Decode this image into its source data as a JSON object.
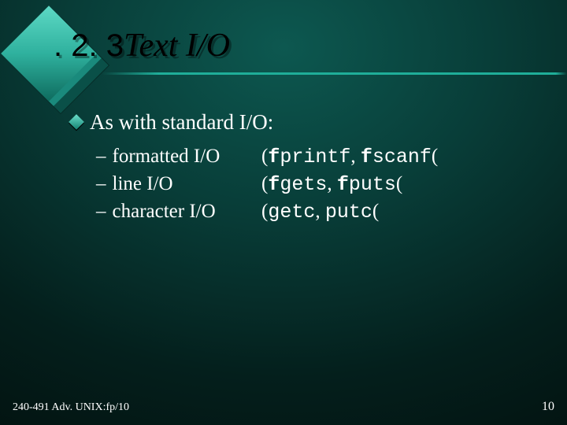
{
  "title": {
    "section_no": ". 2. 3",
    "text": "Text I/O"
  },
  "lead": "As with standard I/O:",
  "rows": [
    {
      "label": "formatted I/O",
      "funcs": [
        "fprintf",
        "fscanf"
      ],
      "bold_prefix_len": 1
    },
    {
      "label": "line I/O",
      "funcs": [
        "fgets",
        "fputs"
      ],
      "bold_prefix_len": 1
    },
    {
      "label": "character I/O",
      "funcs": [
        "getc",
        "putc"
      ],
      "bold_prefix_len": 0
    }
  ],
  "footer": {
    "left": "240-491 Adv. UNIX:fp/10",
    "right": "10"
  }
}
